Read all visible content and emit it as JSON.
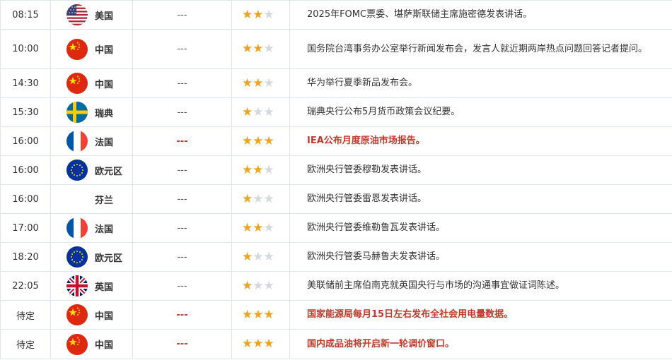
{
  "columns": [
    "time",
    "country",
    "previous",
    "importance",
    "event"
  ],
  "colors": {
    "highlight": "#c0392b",
    "star_on": "#f0a31e",
    "star_off": "#d4d8dc",
    "border": "#dfe6ee"
  },
  "rows": [
    {
      "time": "08:15",
      "flag": "us-flag",
      "country": "美国",
      "value": "---",
      "importance": 2,
      "event": "2025年FOMC票委、堪萨斯联储主席施密德发表讲话。",
      "highlight": false
    },
    {
      "time": "10:00",
      "flag": "china-flag",
      "country": "中国",
      "value": "---",
      "importance": 2,
      "event": "国务院台湾事务办公室举行新闻发布会，发言人就近期两岸热点问题回答记者提问。",
      "highlight": false
    },
    {
      "time": "14:30",
      "flag": "china-flag",
      "country": "中国",
      "value": "---",
      "importance": 2,
      "event": "华为举行夏季新品发布会。",
      "highlight": false
    },
    {
      "time": "15:30",
      "flag": "sweden-flag",
      "country": "瑞典",
      "value": "---",
      "importance": 1,
      "event": "瑞典央行公布5月货币政策会议纪要。",
      "highlight": false
    },
    {
      "time": "16:00",
      "flag": "france-flag",
      "country": "法国",
      "value": "---",
      "importance": 3,
      "event": "IEA公布月度原油市场报告。",
      "highlight": true
    },
    {
      "time": "16:00",
      "flag": "eu-flag",
      "country": "欧元区",
      "value": "---",
      "importance": 2,
      "event": "欧洲央行管委穆勒发表讲话。",
      "highlight": false
    },
    {
      "time": "16:00",
      "flag": "none",
      "country": "芬兰",
      "value": "---",
      "importance": 1,
      "event": "欧洲央行管委雷恩发表讲话。",
      "highlight": false
    },
    {
      "time": "17:00",
      "flag": "france-flag",
      "country": "法国",
      "value": "---",
      "importance": 2,
      "event": "欧洲央行管委维勒鲁瓦发表讲话。",
      "highlight": false
    },
    {
      "time": "18:20",
      "flag": "eu-flag",
      "country": "欧元区",
      "value": "---",
      "importance": 1,
      "event": "欧洲央行管委马赫鲁夫发表讲话。",
      "highlight": false
    },
    {
      "time": "22:05",
      "flag": "uk-flag",
      "country": "英国",
      "value": "---",
      "importance": 1,
      "event": "美联储前主席伯南克就英国央行与市场的沟通事宜做证词陈述。",
      "highlight": false
    },
    {
      "time": "待定",
      "flag": "china-flag",
      "country": "中国",
      "value": "---",
      "importance": 3,
      "event": "国家能源局每月15日左右发布全社会用电量数据。",
      "highlight": true
    },
    {
      "time": "待定",
      "flag": "china-flag",
      "country": "中国",
      "value": "---",
      "importance": 3,
      "event": "国内成品油将开启新一轮调价窗口。",
      "highlight": true
    }
  ]
}
